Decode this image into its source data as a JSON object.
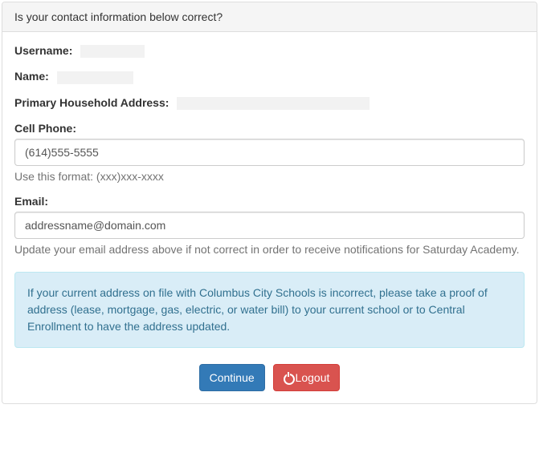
{
  "panel": {
    "heading": "Is your contact information below correct?"
  },
  "fields": {
    "username_label": "Username:",
    "name_label": "Name:",
    "address_label": "Primary Household Address:",
    "cellphone_label": "Cell Phone:",
    "cellphone_value": "(614)555-5555",
    "cellphone_help": "Use this format: (xxx)xxx-xxxx",
    "email_label": "Email:",
    "email_value": "addressname@domain.com",
    "email_help": "Update your email address above if not correct in order to receive notifications for Saturday Academy."
  },
  "alert": {
    "text": "If your current address on file with Columbus City Schools is incorrect, please take a proof of address (lease, mortgage, gas, electric, or water bill) to your current school or to Central Enrollment to have the address updated."
  },
  "buttons": {
    "continue_label": "Continue",
    "logout_label": "Logout"
  }
}
